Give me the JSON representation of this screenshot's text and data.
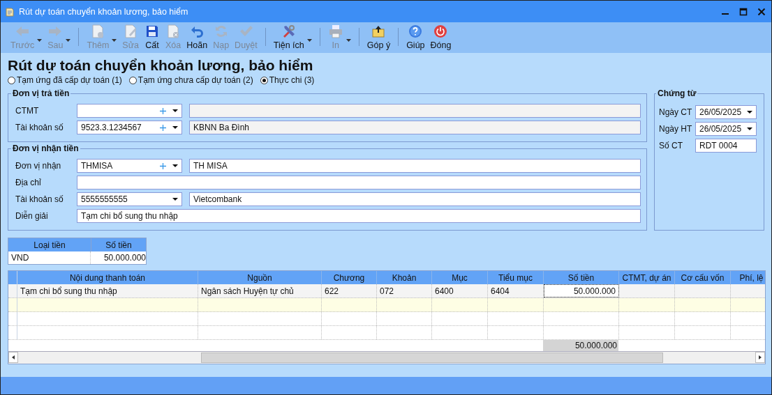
{
  "window": {
    "title": "Rút dự toán chuyển khoản lương, bảo hiểm"
  },
  "toolbar": [
    {
      "kind": "button",
      "label": "Trước",
      "disabled": true,
      "dropdown": true
    },
    {
      "kind": "button",
      "label": "Sau",
      "disabled": true,
      "dropdown": true
    },
    {
      "kind": "separator"
    },
    {
      "kind": "button",
      "label": "Thêm",
      "disabled": true,
      "dropdown": true
    },
    {
      "kind": "button",
      "label": "Sửa",
      "disabled": true,
      "dropdown": false
    },
    {
      "kind": "button",
      "label": "Cất",
      "disabled": false,
      "dropdown": false
    },
    {
      "kind": "button",
      "label": "Xóa",
      "disabled": true,
      "dropdown": false
    },
    {
      "kind": "button",
      "label": "Hoãn",
      "disabled": false,
      "dropdown": false
    },
    {
      "kind": "button",
      "label": "Nạp",
      "disabled": true,
      "dropdown": false
    },
    {
      "kind": "button",
      "label": "Duyệt",
      "disabled": true,
      "dropdown": false
    },
    {
      "kind": "separator"
    },
    {
      "kind": "button",
      "label": "Tiện ích",
      "disabled": false,
      "dropdown": true
    },
    {
      "kind": "separator"
    },
    {
      "kind": "button",
      "label": "In",
      "disabled": true,
      "dropdown": true
    },
    {
      "kind": "separator"
    },
    {
      "kind": "button",
      "label": "Góp ý",
      "disabled": false,
      "dropdown": false
    },
    {
      "kind": "separator"
    },
    {
      "kind": "button",
      "label": "Giúp",
      "disabled": false,
      "dropdown": false
    },
    {
      "kind": "button",
      "label": "Đóng",
      "disabled": false,
      "dropdown": false
    }
  ],
  "heading": "Rút dự toán chuyển khoản lương, bảo hiểm",
  "options": [
    {
      "label": "Tạm ứng đã cấp dự toán (1)",
      "selected": false
    },
    {
      "label": "Tạm ứng chưa cấp dự toán (2)",
      "selected": false
    },
    {
      "label": "Thực chi (3)",
      "selected": true
    }
  ],
  "payer": {
    "title": "Đơn vị trả tiền",
    "rows": [
      {
        "kind": "combo",
        "label": "CTMT",
        "add": true,
        "name_readonly": true
      },
      {
        "kind": "combo",
        "label": "Tài khoản số",
        "value": "9523.3.1234567",
        "add": true,
        "name": "KBNN Ba Đình",
        "name_readonly": true
      }
    ]
  },
  "receiver": {
    "title": "Đơn vị nhận tiền",
    "rows": [
      {
        "kind": "combo",
        "label": "Đơn vị nhận",
        "value": "THMISA",
        "add": true,
        "name": "TH MISA",
        "name_readonly": false
      },
      {
        "kind": "text",
        "label": "Địa chỉ"
      },
      {
        "kind": "combo",
        "label": "Tài khoản số",
        "value": "5555555555",
        "add": false,
        "name": "Vietcombank",
        "name_readonly": false
      },
      {
        "kind": "text",
        "label": "Diễn giải",
        "value": "Tạm chi bổ sung thu nhập"
      }
    ]
  },
  "voucher": {
    "title": "Chứng từ",
    "rows": [
      {
        "kind": "date",
        "label": "Ngày CT",
        "value": "26/05/2025"
      },
      {
        "kind": "date",
        "label": "Ngày HT",
        "value": "26/05/2025"
      },
      {
        "kind": "text",
        "label": "Số CT",
        "value": "RDT 0004"
      }
    ]
  },
  "currency_table": {
    "columns": [
      "Loại tiền",
      "Số tiền"
    ],
    "rows": [
      [
        "VND",
        "50.000.000"
      ]
    ]
  },
  "grid": {
    "columns": [
      "Nội dung thanh toán",
      "Nguồn",
      "Chương",
      "Khoản",
      "Mục",
      "Tiểu mục",
      "Số tiền",
      "CTMT, dự án",
      "Cơ cấu vốn",
      "Phí, lệ"
    ],
    "rows": [
      {
        "cells": [
          {
            "text": "Tạm chi bổ sung thu nhập",
            "focused": false
          },
          {
            "text": "Ngân sách Huyện tự chủ",
            "focused": false
          },
          {
            "text": "622",
            "focused": false
          },
          {
            "text": "072",
            "focused": false
          },
          {
            "text": "6400",
            "focused": false
          },
          {
            "text": "6404",
            "focused": false
          },
          {
            "text": "50.000.000",
            "focused": true
          },
          {
            "focused": false
          },
          {
            "focused": false
          },
          {
            "focused": false
          }
        ]
      }
    ],
    "new_row_highlighted": true,
    "total": "50.000.000"
  }
}
